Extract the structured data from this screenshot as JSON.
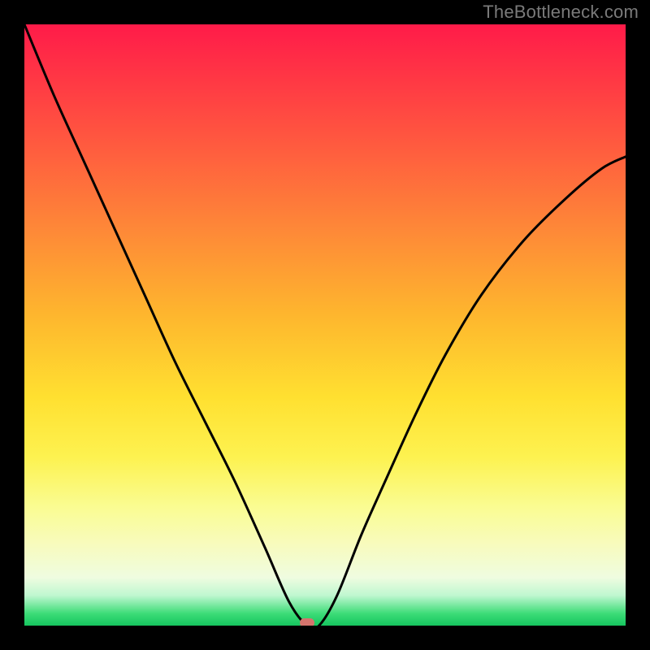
{
  "watermark": "TheBottleneck.com",
  "colors": {
    "curve_stroke": "#000000",
    "vertex_fill": "#d5746d",
    "frame_bg": "#000000"
  },
  "chart_data": {
    "type": "line",
    "title": "",
    "xlabel": "",
    "ylabel": "",
    "xlim": [
      0,
      1
    ],
    "ylim": [
      0,
      1
    ],
    "grid": false,
    "legend": false,
    "vertex": {
      "x": 0.47,
      "y": 0.0
    },
    "series": [
      {
        "name": "curve",
        "x": [
          0.0,
          0.05,
          0.1,
          0.15,
          0.2,
          0.25,
          0.3,
          0.35,
          0.4,
          0.44,
          0.47,
          0.49,
          0.52,
          0.56,
          0.6,
          0.65,
          0.7,
          0.76,
          0.83,
          0.9,
          0.96,
          1.0
        ],
        "y": [
          1.0,
          0.88,
          0.77,
          0.66,
          0.55,
          0.44,
          0.34,
          0.24,
          0.13,
          0.04,
          0.0,
          0.0,
          0.05,
          0.15,
          0.24,
          0.35,
          0.45,
          0.55,
          0.64,
          0.71,
          0.76,
          0.78
        ]
      }
    ]
  }
}
